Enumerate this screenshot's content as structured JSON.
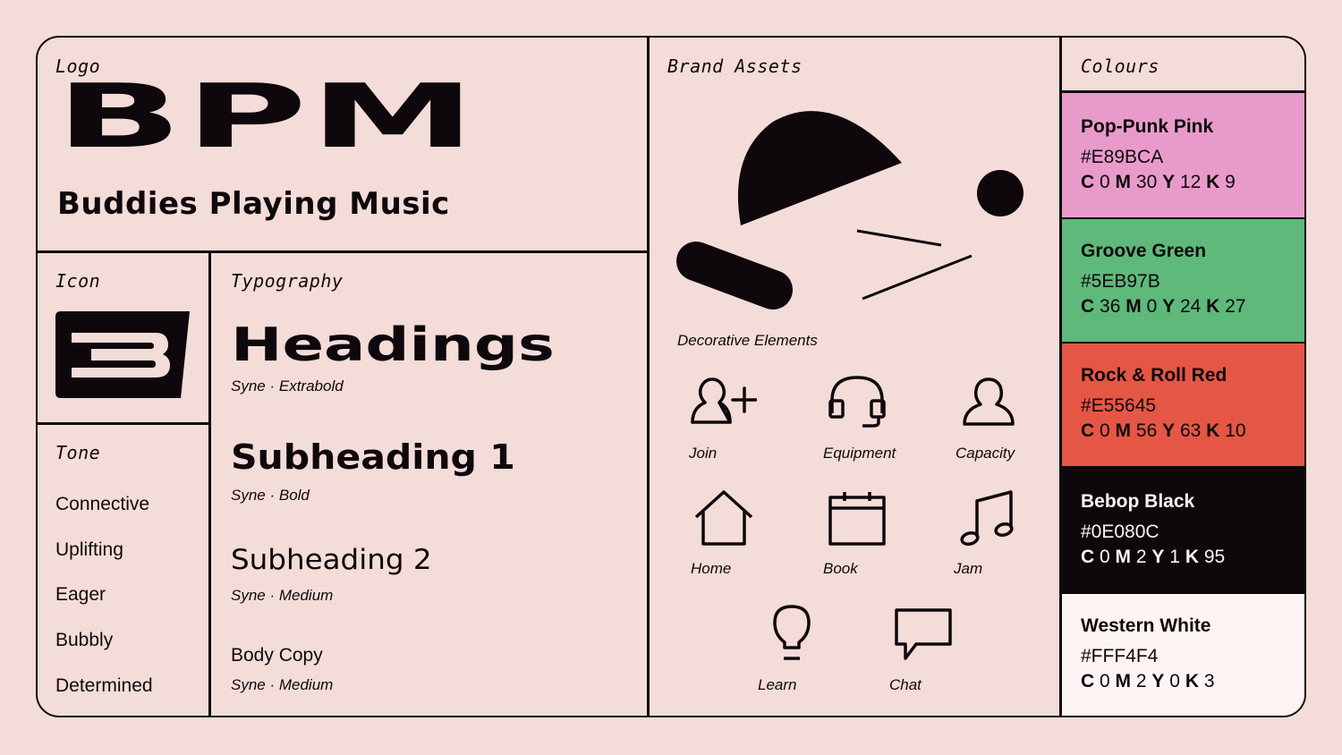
{
  "logo": {
    "label": "Logo",
    "wordmark": "BPM",
    "tagline": "Buddies Playing Music"
  },
  "icon_section": {
    "label": "Icon",
    "glyph": "B"
  },
  "tone": {
    "label": "Tone",
    "items": [
      "Connective",
      "Uplifting",
      "Eager",
      "Bubbly",
      "Determined"
    ]
  },
  "typography": {
    "label": "Typography",
    "styles": [
      {
        "sample": "Headings",
        "caption": "Syne · Extrabold"
      },
      {
        "sample": "Subheading 1",
        "caption": "Syne · Bold"
      },
      {
        "sample": "Subheading 2",
        "caption": "Syne · Medium"
      },
      {
        "sample": "Body Copy",
        "caption": "Syne · Medium"
      }
    ]
  },
  "brand_assets": {
    "label": "Brand Assets",
    "decorative_caption": "Decorative Elements",
    "icons": [
      {
        "icon": "add-user-icon",
        "label": "Join"
      },
      {
        "icon": "headphones-icon",
        "label": "Equipment"
      },
      {
        "icon": "user-icon",
        "label": "Capacity"
      },
      {
        "icon": "home-icon",
        "label": "Home"
      },
      {
        "icon": "calendar-icon",
        "label": "Book"
      },
      {
        "icon": "music-note-icon",
        "label": "Jam"
      },
      {
        "icon": "lightbulb-icon",
        "label": "Learn"
      },
      {
        "icon": "chat-bubble-icon",
        "label": "Chat"
      }
    ]
  },
  "colours": {
    "label": "Colours",
    "swatches": [
      {
        "name": "Pop-Punk Pink",
        "hex": "#E89BCA",
        "c": "0",
        "m": "30",
        "y": "12",
        "k": "9",
        "text_color": "#0E080C"
      },
      {
        "name": "Groove Green",
        "hex": "#5EB97B",
        "c": "36",
        "m": "0",
        "y": "24",
        "k": "27",
        "text_color": "#0E080C"
      },
      {
        "name": "Rock & Roll Red",
        "hex": "#E55645",
        "c": "0",
        "m": "56",
        "y": "63",
        "k": "10",
        "text_color": "#0E080C"
      },
      {
        "name": "Bebop Black",
        "hex": "#0E080C",
        "c": "0",
        "m": "2",
        "y": "1",
        "k": "95",
        "text_color": "#FFF4F4"
      },
      {
        "name": "Western White",
        "hex": "#FFF4F4",
        "c": "0",
        "m": "2",
        "y": "0",
        "k": "3",
        "text_color": "#0E080C"
      }
    ]
  },
  "theme": {
    "background": "#F4DCD8",
    "ink": "#0E080C"
  }
}
